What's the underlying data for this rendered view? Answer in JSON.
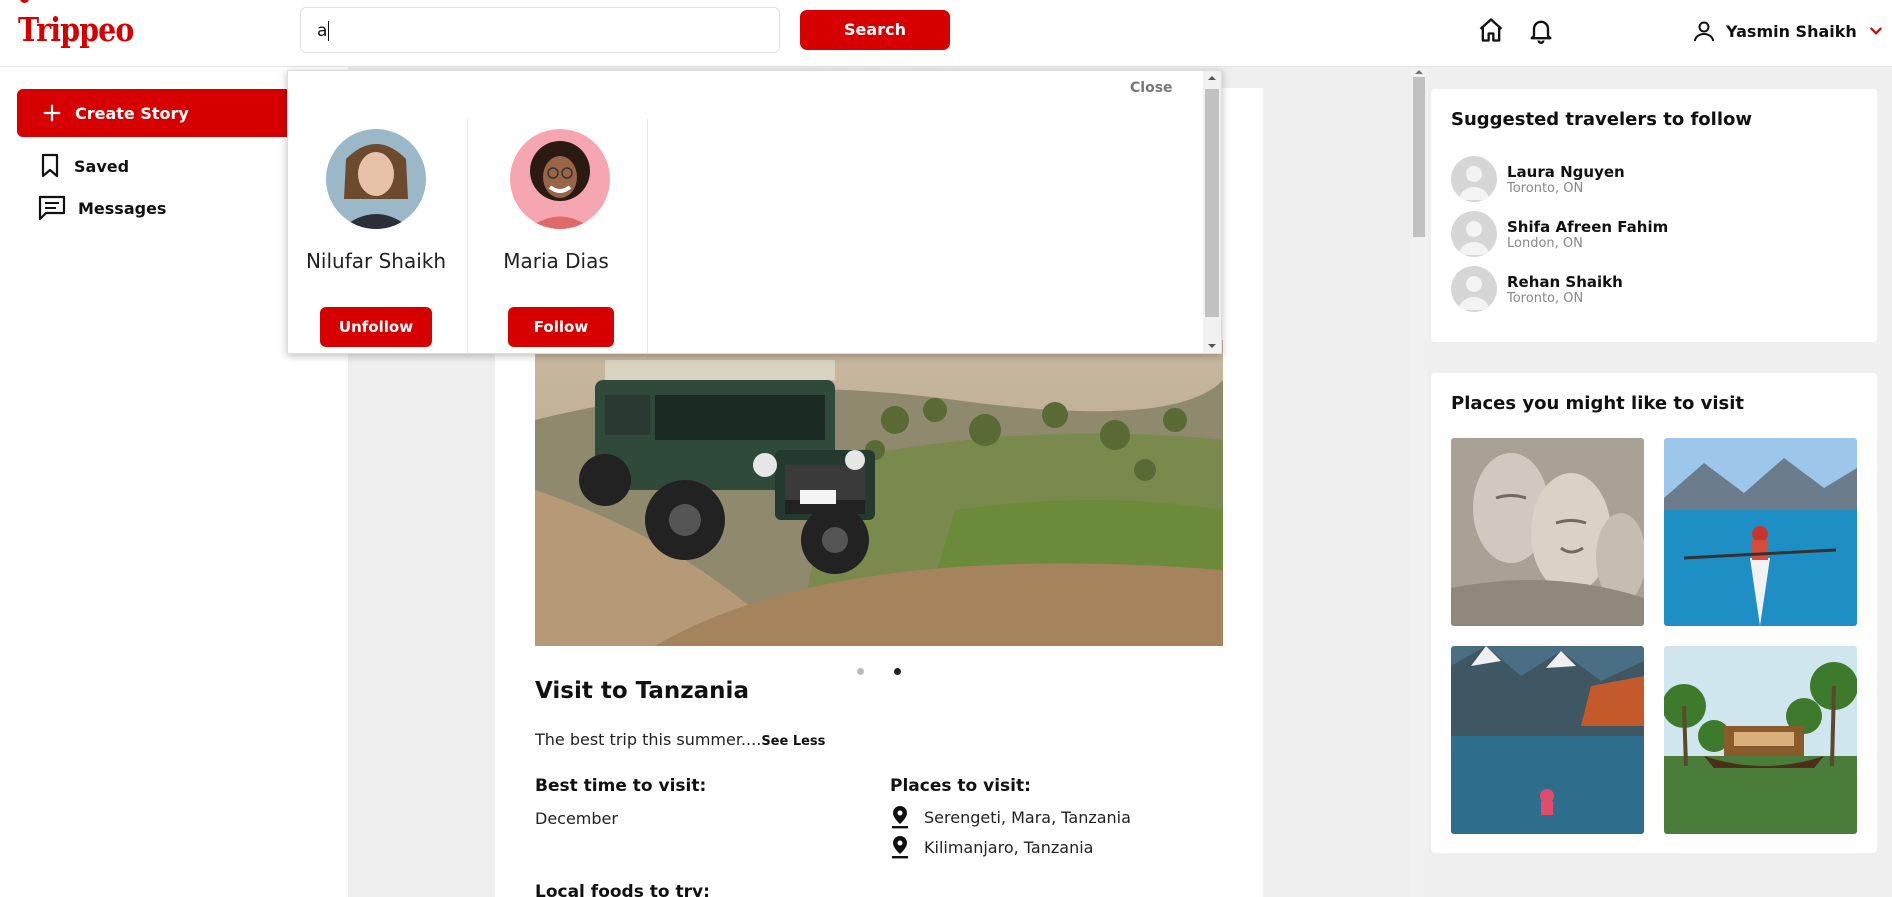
{
  "header": {
    "logo": "Trippeo",
    "search_value": "a",
    "search_button": "Search",
    "user_name": "Yasmin Shaikh"
  },
  "sidebar": {
    "create_story": "Create Story",
    "items": [
      {
        "label": "Saved",
        "icon": "bookmark-icon"
      },
      {
        "label": "Messages",
        "icon": "message-icon"
      }
    ]
  },
  "search_results": {
    "close_label": "Close",
    "people": [
      {
        "name": "Nilufar Shaikh",
        "action": "Unfollow"
      },
      {
        "name": "Maria Dias",
        "action": "Follow"
      }
    ]
  },
  "post": {
    "title": "Visit to Tanzania",
    "text": "The best trip this summer....",
    "see_less": "See Less",
    "best_time_label": "Best time to visit:",
    "best_time_value": "December",
    "places_label": "Places to visit:",
    "places": [
      "Serengeti, Mara, Tanzania",
      "Kilimanjaro, Tanzania"
    ],
    "local_foods_label": "Local foods to try:",
    "carousel_active_index": 2,
    "carousel_total": 2
  },
  "suggested": {
    "title": "Suggested travelers to follow",
    "travelers": [
      {
        "name": "Laura Nguyen",
        "location": "Toronto, ON"
      },
      {
        "name": "Shifa Afreen Fahim",
        "location": "London, ON"
      },
      {
        "name": "Rehan Shaikh",
        "location": "Toronto, ON"
      }
    ]
  },
  "places_panel": {
    "title": "Places you might like to visit"
  },
  "colors": {
    "brand": "#d60000",
    "page_bg": "#efefef"
  }
}
